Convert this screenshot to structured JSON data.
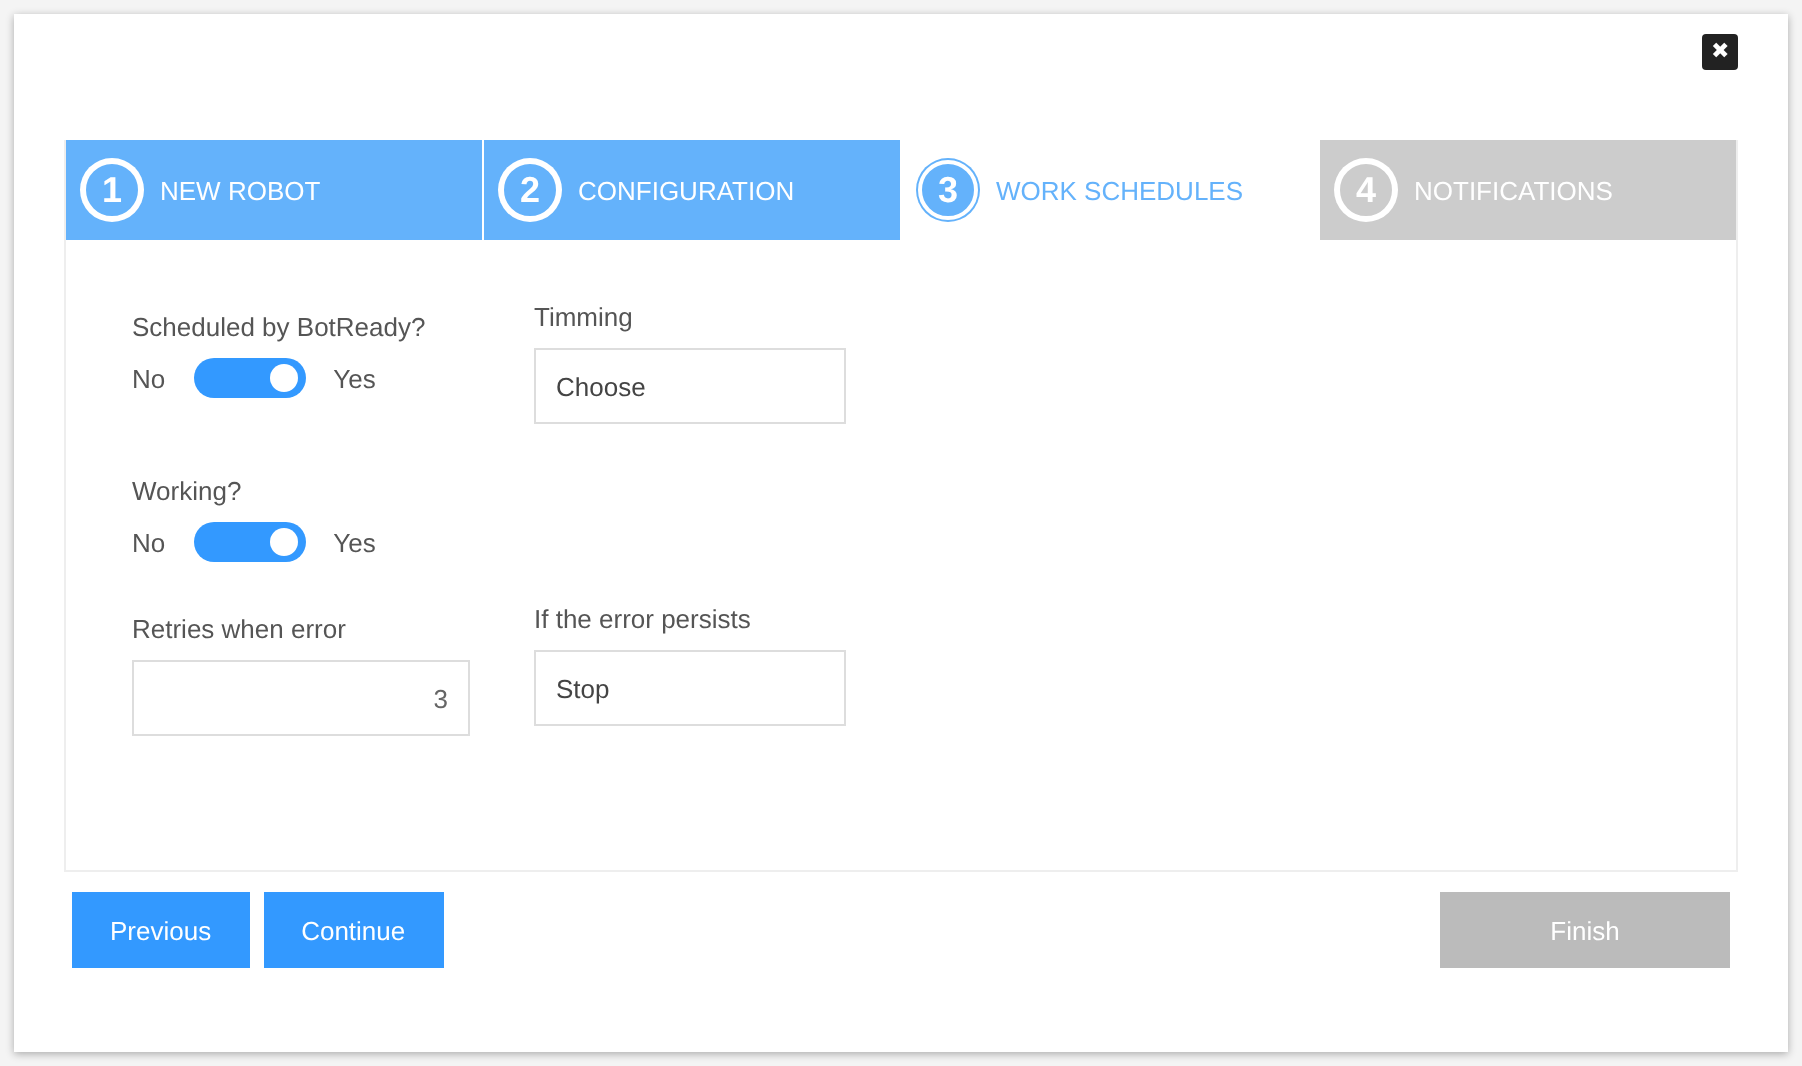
{
  "dialog": {
    "close_icon": "✖"
  },
  "steps": [
    {
      "number": "1",
      "label": "NEW ROBOT",
      "done": true,
      "selected": false
    },
    {
      "number": "2",
      "label": "CONFIGURATION",
      "done": true,
      "selected": false
    },
    {
      "number": "3",
      "label": "WORK SCHEDULES",
      "done": false,
      "selected": true
    },
    {
      "number": "4",
      "label": "NOTIFICATIONS",
      "done": false,
      "selected": false
    }
  ],
  "form": {
    "scheduled": {
      "label": "Scheduled by BotReady?",
      "off_label": "No",
      "on_label": "Yes",
      "on": true
    },
    "timing": {
      "label": "Timming",
      "value": "Choose"
    },
    "working": {
      "label": "Working?",
      "off_label": "No",
      "on_label": "Yes",
      "on": true
    },
    "retries": {
      "label": "Retries when error",
      "value": "3"
    },
    "persist": {
      "label": "If the error persists",
      "value": "Stop"
    }
  },
  "buttons": [
    {
      "label": "Previous",
      "disabled": false
    },
    {
      "label": "Continue",
      "disabled": false
    },
    {
      "label": "Finish",
      "disabled": true
    }
  ]
}
